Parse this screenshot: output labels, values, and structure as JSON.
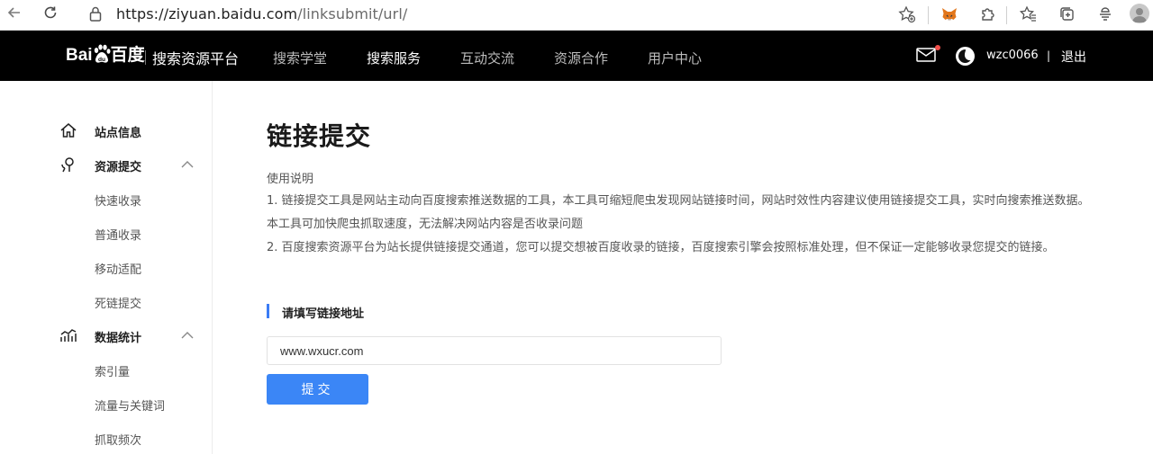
{
  "browser": {
    "url_domain": "https://ziyuan.baidu.com",
    "url_path": "/linksubmit/url/"
  },
  "header": {
    "logo_text": "Bai",
    "logo_cn": "百度",
    "platform_name": "搜索资源平台",
    "nav": [
      {
        "label": "搜索学堂",
        "active": false
      },
      {
        "label": "搜索服务",
        "active": true
      },
      {
        "label": "互动交流",
        "active": false
      },
      {
        "label": "资源合作",
        "active": false
      },
      {
        "label": "用户中心",
        "active": false
      }
    ],
    "username": "wzc0066",
    "separator": "|",
    "logout": "退出"
  },
  "sidebar": {
    "groups": [
      {
        "label": "站点信息",
        "icon": "home-icon"
      },
      {
        "label": "资源提交",
        "icon": "resource-submit-icon",
        "expanded": true,
        "items": [
          "快速收录",
          "普通收录",
          "移动适配",
          "死链提交"
        ]
      },
      {
        "label": "数据统计",
        "icon": "stats-icon",
        "expanded": true,
        "items": [
          "索引量",
          "流量与关键词",
          "抓取频次"
        ]
      }
    ]
  },
  "main": {
    "title": "链接提交",
    "instructions_title": "使用说明",
    "instructions": [
      "1. 链接提交工具是网站主动向百度搜索推送数据的工具，本工具可缩短爬虫发现网站链接时间，网站时效性内容建议使用链接提交工具，实时向搜索推送数据。本工具可加快爬虫抓取速度，无法解决网站内容是否收录问题",
      "2. 百度搜索资源平台为站长提供链接提交通道，您可以提交想被百度收录的链接，百度搜索引擎会按照标准处理，但不保证一定能够收录您提交的链接。"
    ],
    "section_label": "请填写链接地址",
    "url_input_value": "www.wxucr.com",
    "submit_label": "提交"
  },
  "colors": {
    "header_bg": "#000000",
    "accent": "#3b86f6",
    "notification_dot": "#f2504b"
  }
}
